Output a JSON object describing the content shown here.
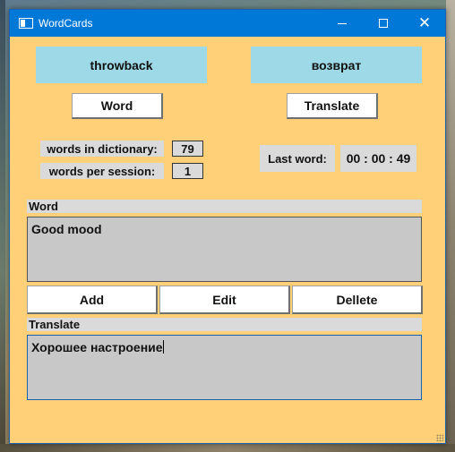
{
  "window": {
    "title": "WordCards"
  },
  "title_buttons": {
    "minimize": "minimize",
    "maximize": "maximize",
    "close": "✕"
  },
  "top_buttons": {
    "throwback": "throwback",
    "vozvrat": "возврат"
  },
  "mode_buttons": {
    "word": "Word",
    "translate": "Translate"
  },
  "stats": {
    "words_in_dictionary_label": "words in dictionary:",
    "words_in_dictionary_value": "79",
    "words_per_session_label": "words per session:",
    "words_per_session_value": "1",
    "last_word_label": "Last word:",
    "last_word_time": "00 : 00 : 49"
  },
  "word_section": {
    "label": "Word",
    "text": "Good mood"
  },
  "actions": {
    "add": "Add",
    "edit": "Edit",
    "delete": "Dellete"
  },
  "translate_section": {
    "label": "Translate",
    "text": "Хорошее настроение"
  },
  "colors": {
    "window_bg": "#ffd077",
    "titlebar": "#0078d7",
    "blue_button": "#9dd9e7",
    "textarea_bg": "#c8c8c8"
  }
}
